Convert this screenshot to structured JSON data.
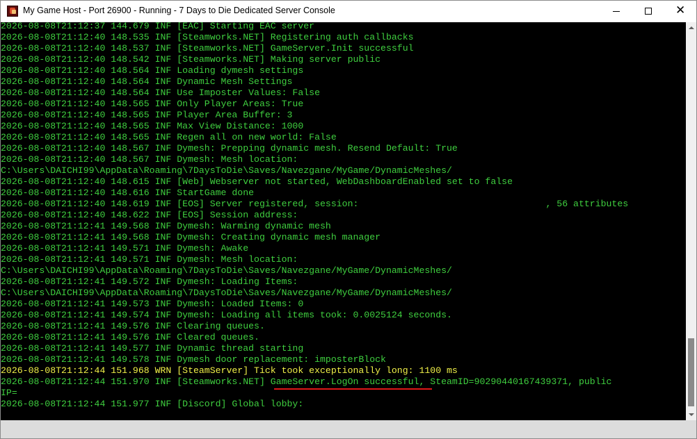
{
  "window": {
    "title": "My Game Host - Port 26900 - Running - 7 Days to Die Dedicated Server Console",
    "icon": "7-days-to-die-app-icon",
    "controls": {
      "minimize": "minimize-icon",
      "maximize": "maximize-icon",
      "close": "✕"
    }
  },
  "console": {
    "lines": [
      {
        "text": "2026-08-08T21:12:37 144.679 INF [EAC] Starting EAC server",
        "level": "INF"
      },
      {
        "text": "2026-08-08T21:12:40 148.535 INF [Steamworks.NET] Registering auth callbacks",
        "level": "INF"
      },
      {
        "text": "2026-08-08T21:12:40 148.537 INF [Steamworks.NET] GameServer.Init successful",
        "level": "INF"
      },
      {
        "text": "2026-08-08T21:12:40 148.542 INF [Steamworks.NET] Making server public",
        "level": "INF"
      },
      {
        "text": "2026-08-08T21:12:40 148.564 INF Loading dymesh settings",
        "level": "INF"
      },
      {
        "text": "2026-08-08T21:12:40 148.564 INF Dynamic Mesh Settings",
        "level": "INF"
      },
      {
        "text": "2026-08-08T21:12:40 148.564 INF Use Imposter Values: False",
        "level": "INF"
      },
      {
        "text": "2026-08-08T21:12:40 148.565 INF Only Player Areas: True",
        "level": "INF"
      },
      {
        "text": "2026-08-08T21:12:40 148.565 INF Player Area Buffer: 3",
        "level": "INF"
      },
      {
        "text": "2026-08-08T21:12:40 148.565 INF Max View Distance: 1000",
        "level": "INF"
      },
      {
        "text": "2026-08-08T21:12:40 148.565 INF Regen all on new world: False",
        "level": "INF"
      },
      {
        "text": "2026-08-08T21:12:40 148.567 INF Dymesh: Prepping dynamic mesh. Resend Default: True",
        "level": "INF"
      },
      {
        "text": "2026-08-08T21:12:40 148.567 INF Dymesh: Mesh location:",
        "level": "INF"
      },
      {
        "text": "C:\\Users\\DAICHI99\\AppData\\Roaming\\7DaysToDie\\Saves/Navezgane/MyGame/DynamicMeshes/",
        "level": "INF"
      },
      {
        "text": "2026-08-08T21:12:40 148.615 INF [Web] Webserver not started, WebDashboardEnabled set to false",
        "level": "INF"
      },
      {
        "text": "2026-08-08T21:12:40 148.616 INF StartGame done",
        "level": "INF"
      },
      {
        "text": "2026-08-08T21:12:40 148.619 INF [EOS] Server registered, session:                                  , 56 attributes",
        "level": "INF"
      },
      {
        "text": "2026-08-08T21:12:40 148.622 INF [EOS] Session address:",
        "level": "INF"
      },
      {
        "text": "2026-08-08T21:12:41 149.568 INF Dymesh: Warming dynamic mesh",
        "level": "INF"
      },
      {
        "text": "2026-08-08T21:12:41 149.568 INF Dymesh: Creating dynamic mesh manager",
        "level": "INF"
      },
      {
        "text": "2026-08-08T21:12:41 149.571 INF Dymesh: Awake",
        "level": "INF"
      },
      {
        "text": "2026-08-08T21:12:41 149.571 INF Dymesh: Mesh location:",
        "level": "INF"
      },
      {
        "text": "C:\\Users\\DAICHI99\\AppData\\Roaming\\7DaysToDie\\Saves/Navezgane/MyGame/DynamicMeshes/",
        "level": "INF"
      },
      {
        "text": "2026-08-08T21:12:41 149.572 INF Dymesh: Loading Items:",
        "level": "INF"
      },
      {
        "text": "C:\\Users\\DAICHI99\\AppData\\Roaming\\7DaysToDie\\Saves/Navezgane/MyGame/DynamicMeshes/",
        "level": "INF"
      },
      {
        "text": "2026-08-08T21:12:41 149.573 INF Dymesh: Loaded Items: 0",
        "level": "INF"
      },
      {
        "text": "2026-08-08T21:12:41 149.574 INF Dymesh: Loading all items took: 0.0025124 seconds.",
        "level": "INF"
      },
      {
        "text": "2026-08-08T21:12:41 149.576 INF Clearing queues.",
        "level": "INF"
      },
      {
        "text": "2026-08-08T21:12:41 149.576 INF Cleared queues.",
        "level": "INF"
      },
      {
        "text": "2026-08-08T21:12:41 149.577 INF Dynamic thread starting",
        "level": "INF"
      },
      {
        "text": "2026-08-08T21:12:41 149.578 INF Dymesh door replacement: imposterBlock",
        "level": "INF"
      },
      {
        "text": "2026-08-08T21:12:44 151.968 WRN [SteamServer] Tick took exceptionally long: 1100 ms",
        "level": "WRN"
      },
      {
        "text": "2026-08-08T21:12:44 151.970 INF [Steamworks.NET] GameServer.LogOn successful, SteamID=90290440167439371, public",
        "level": "INF"
      },
      {
        "text": "IP=",
        "level": "INF"
      },
      {
        "text": "2026-08-08T21:12:44 151.977 INF [Discord] Global lobby:",
        "level": "INF"
      }
    ]
  },
  "colors": {
    "console_background": "#000000",
    "info_text": "#3fcf3f",
    "warning_text": "#f0f048",
    "annotation_underline": "#e01818"
  },
  "annotation": {
    "type": "red-underline",
    "target_text": "GameServer.LogOn successful,"
  }
}
